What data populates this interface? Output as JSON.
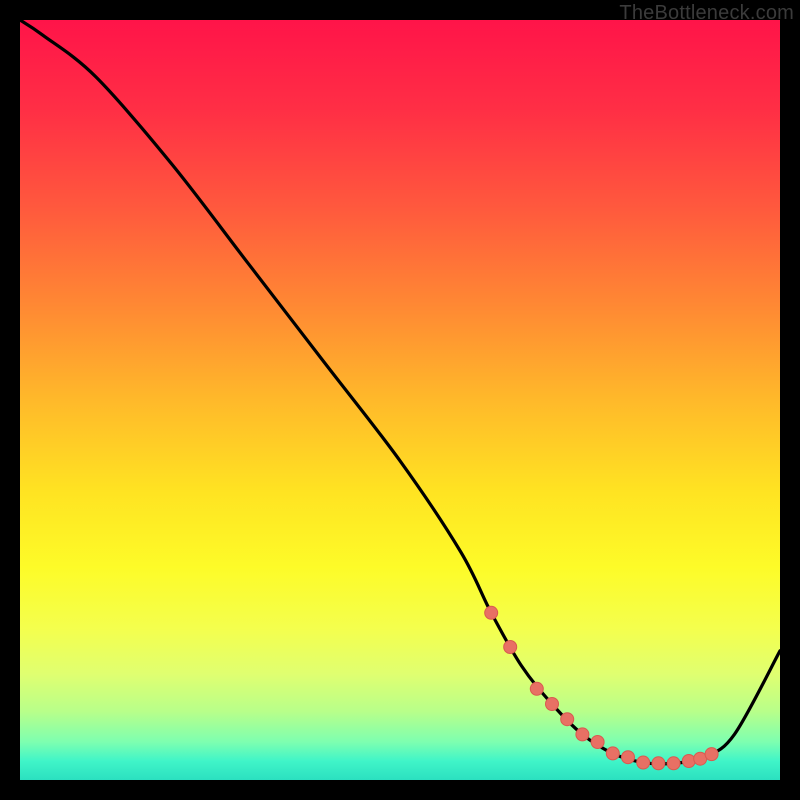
{
  "watermark": "TheBottleneck.com",
  "gradient_stops": [
    {
      "offset": 0.0,
      "color": "#ff1449"
    },
    {
      "offset": 0.12,
      "color": "#ff2f45"
    },
    {
      "offset": 0.25,
      "color": "#ff5a3d"
    },
    {
      "offset": 0.38,
      "color": "#ff8a33"
    },
    {
      "offset": 0.5,
      "color": "#ffb92a"
    },
    {
      "offset": 0.62,
      "color": "#ffe322"
    },
    {
      "offset": 0.72,
      "color": "#fdfb28"
    },
    {
      "offset": 0.8,
      "color": "#f4ff4d"
    },
    {
      "offset": 0.86,
      "color": "#e0ff70"
    },
    {
      "offset": 0.91,
      "color": "#b8ff8a"
    },
    {
      "offset": 0.95,
      "color": "#7dffb0"
    },
    {
      "offset": 0.975,
      "color": "#40f5c8"
    },
    {
      "offset": 1.0,
      "color": "#2be0c0"
    }
  ],
  "dot_color": "#e87064",
  "dot_color_stroke": "#d85a50",
  "chart_data": {
    "type": "line",
    "title": "",
    "xlabel": "",
    "ylabel": "",
    "xlim": [
      0,
      100
    ],
    "ylim": [
      0,
      100
    ],
    "grid": false,
    "annotations": [
      "TheBottleneck.com"
    ],
    "series": [
      {
        "name": "curve",
        "x": [
          0,
          3,
          10,
          20,
          30,
          40,
          50,
          58,
          62,
          66,
          70,
          74,
          78,
          82,
          86,
          90,
          94,
          100
        ],
        "y": [
          100,
          98,
          92.5,
          81,
          68,
          55,
          42,
          30,
          22,
          15,
          10,
          6,
          3.5,
          2.3,
          2.2,
          3,
          6,
          17
        ]
      },
      {
        "name": "highlight-dots",
        "x": [
          62,
          64.5,
          68,
          70,
          72,
          74,
          76,
          78,
          80,
          82,
          84,
          86,
          88,
          89.5,
          91
        ],
        "y": [
          22,
          17.5,
          12,
          10,
          8,
          6,
          5,
          3.5,
          3,
          2.3,
          2.2,
          2.2,
          2.5,
          2.8,
          3.4
        ]
      }
    ]
  }
}
